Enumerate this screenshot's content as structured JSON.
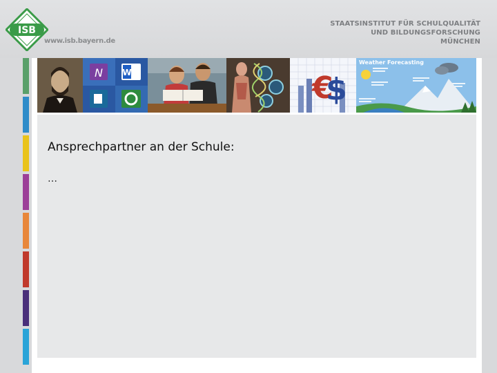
{
  "header": {
    "logo_text": "ISB",
    "site_url": "www.isb.bayern.de",
    "institute_lines": [
      "STAATSINSTITUT FÜR SCHULQUALITÄT",
      "UND BILDUNGSFORSCHUNG",
      "MÜNCHEN"
    ]
  },
  "banner": {
    "tiles": [
      "portrait-lincoln",
      "office-icons",
      "students-reading",
      "biology-dna",
      "economics-euro",
      "weather-forecasting"
    ],
    "weather_title": "Weather Forecasting"
  },
  "slide": {
    "heading": "Ansprechpartner an der Schule:",
    "body": "…"
  },
  "colors": {
    "stripes": [
      "#5aa06a",
      "#2f8cc9",
      "#e9c31b",
      "#9c3f98",
      "#e8873a",
      "#c0392b",
      "#4a2f7a",
      "#2aa4d8"
    ],
    "logo_green": "#3a9b48"
  }
}
